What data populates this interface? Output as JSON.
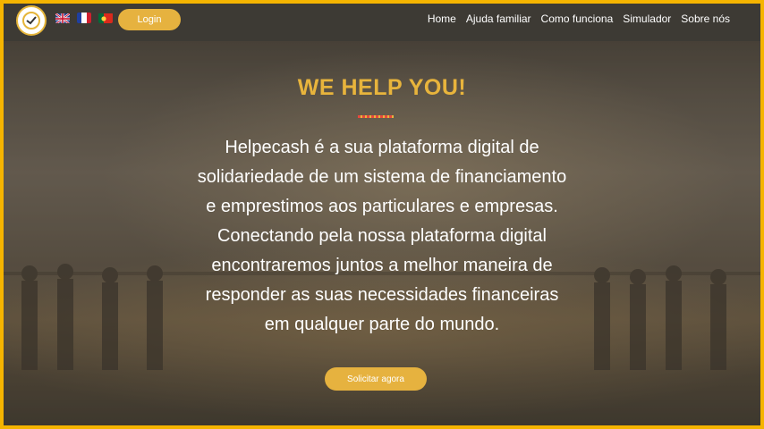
{
  "header": {
    "logo_icon": "helpecash-logo",
    "languages": [
      {
        "code": "en",
        "icon": "uk-flag-icon"
      },
      {
        "code": "fr",
        "icon": "france-flag-icon"
      },
      {
        "code": "pt",
        "icon": "portugal-flag-icon"
      }
    ],
    "login_label": "Login",
    "nav": [
      {
        "label": "Home"
      },
      {
        "label": "Ajuda familiar"
      },
      {
        "label": "Como funciona"
      },
      {
        "label": "Simulador"
      },
      {
        "label": "Sobre nós"
      }
    ]
  },
  "hero": {
    "title": "WE HELP YOU!",
    "lines": [
      "Helpecash é a sua plataforma digital de",
      "solidariedade de um sistema de financiamento",
      "e emprestimos aos particulares e empresas.",
      "Conectando pela nossa plataforma digital",
      "encontraremos juntos a melhor maneira de",
      "responder as suas necessidades financeiras",
      "em qualquer parte do mundo."
    ],
    "cta_label": "Solicitar agora"
  },
  "colors": {
    "accent": "#e6b23f",
    "frame": "#f5b400",
    "topbar": "#3d3a34"
  }
}
